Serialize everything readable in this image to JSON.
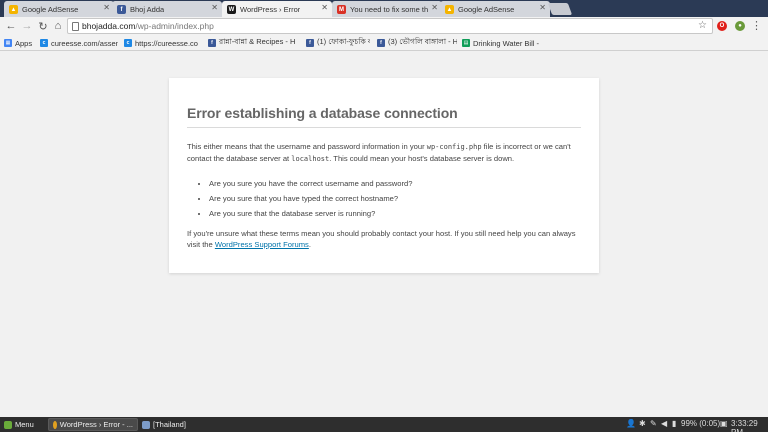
{
  "tabs": [
    {
      "label": "Google AdSense",
      "icon": "adsense-icon",
      "active": false
    },
    {
      "label": "Bhoj Adda",
      "icon": "facebook-icon",
      "active": false
    },
    {
      "label": "WordPress › Error",
      "icon": "wordpress-icon",
      "active": true
    },
    {
      "label": "You need to fix some th",
      "icon": "gmail-icon",
      "active": false
    },
    {
      "label": "Google AdSense",
      "icon": "adsense-icon",
      "active": false
    }
  ],
  "toolbar": {
    "url_host": "bhojadda.com",
    "url_path": "/wp-admin/index.php"
  },
  "bookmarks": [
    {
      "label": "Apps"
    },
    {
      "label": "cureesse.com/assen"
    },
    {
      "label": "https://cureesse.co"
    },
    {
      "label": "রান্না-বান্না & Recipes - H"
    },
    {
      "label": "(1) ফোকা-ফুচকি বাঙ্গালা H"
    },
    {
      "label": "(3) ভৌগলি বাঙ্গালা - Home"
    },
    {
      "label": "Drinking Water Bill -"
    }
  ],
  "error_page": {
    "title": "Error establishing a database connection",
    "p1_before": "This either means that the username and password information in your ",
    "p1_code1": "wp-config.php",
    "p1_middle": " file is incorrect or we can't contact the database server at ",
    "p1_code2": "localhost",
    "p1_after": ". This could mean your host's database server is down.",
    "checks": [
      "Are you sure you have the correct username and password?",
      "Are you sure that you have typed the correct hostname?",
      "Are you sure that the database server is running?"
    ],
    "p2_before": "If you're unsure what these terms mean you should probably contact your host. If you still need help you can always visit the ",
    "p2_link": "WordPress Support Forums",
    "p2_after": "."
  },
  "taskbar": {
    "menu_label": "Menu",
    "window1": "WordPress › Error - ...",
    "window2": "[Thailand]",
    "battery": "99% (0:05)",
    "clock": "3:33:29 PM"
  },
  "colors": {
    "link": "#0073aa",
    "tabstrip_bg": "#2b3a55",
    "taskbar_bg": "#2e2e2e"
  }
}
